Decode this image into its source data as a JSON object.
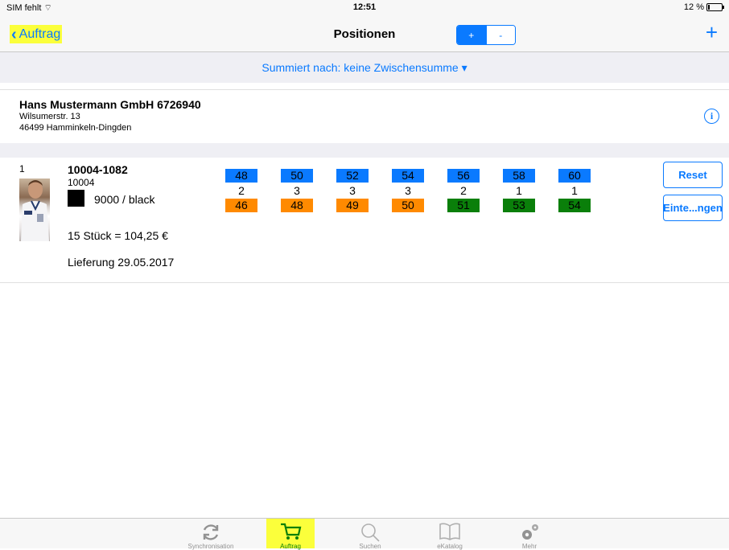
{
  "status": {
    "carrier": "SIM fehlt",
    "time": "12:51",
    "battery": "12 %"
  },
  "nav": {
    "back_label": "Auftrag",
    "title": "Positionen",
    "segment": [
      "+",
      "-"
    ],
    "add_glyph": "+"
  },
  "summary": {
    "label": "Summiert nach: keine Zwischensumme ▾"
  },
  "customer": {
    "name": "Hans Mustermann GmbH 6726940",
    "street": "Wilsumerstr. 13",
    "city": "46499 Hamminkeln-Dingden",
    "info_glyph": "i"
  },
  "position": {
    "number": "1",
    "article": "10004-1082",
    "sub": "10004",
    "color_label": "9000 / black",
    "swatch_color": "#000000",
    "total": "15 Stück = 104,25 €",
    "delivery": "Lieferung 29.05.2017",
    "sizes": [
      {
        "size": "48",
        "qty": "2",
        "stock": "46",
        "stock_status": "orange"
      },
      {
        "size": "50",
        "qty": "3",
        "stock": "48",
        "stock_status": "orange"
      },
      {
        "size": "52",
        "qty": "3",
        "stock": "49",
        "stock_status": "orange"
      },
      {
        "size": "54",
        "qty": "3",
        "stock": "50",
        "stock_status": "orange"
      },
      {
        "size": "56",
        "qty": "2",
        "stock": "51",
        "stock_status": "green"
      },
      {
        "size": "58",
        "qty": "1",
        "stock": "53",
        "stock_status": "green"
      },
      {
        "size": "60",
        "qty": "1",
        "stock": "54",
        "stock_status": "green"
      }
    ],
    "reset_label": "Reset",
    "settings_label": "Einte...ngen"
  },
  "tabs": [
    {
      "label": "Synchronisation",
      "icon": "sync-icon"
    },
    {
      "label": "Auftrag",
      "icon": "cart-icon",
      "active": true
    },
    {
      "label": "Suchen",
      "icon": "search-icon"
    },
    {
      "label": "eKatalog",
      "icon": "book-icon"
    },
    {
      "label": "Mehr",
      "icon": "gears-icon"
    }
  ],
  "colors": {
    "accent": "#0a7aff",
    "highlight": "#fbff3b",
    "stock_orange": "#ff8a00",
    "stock_green": "#0a7f0a"
  }
}
